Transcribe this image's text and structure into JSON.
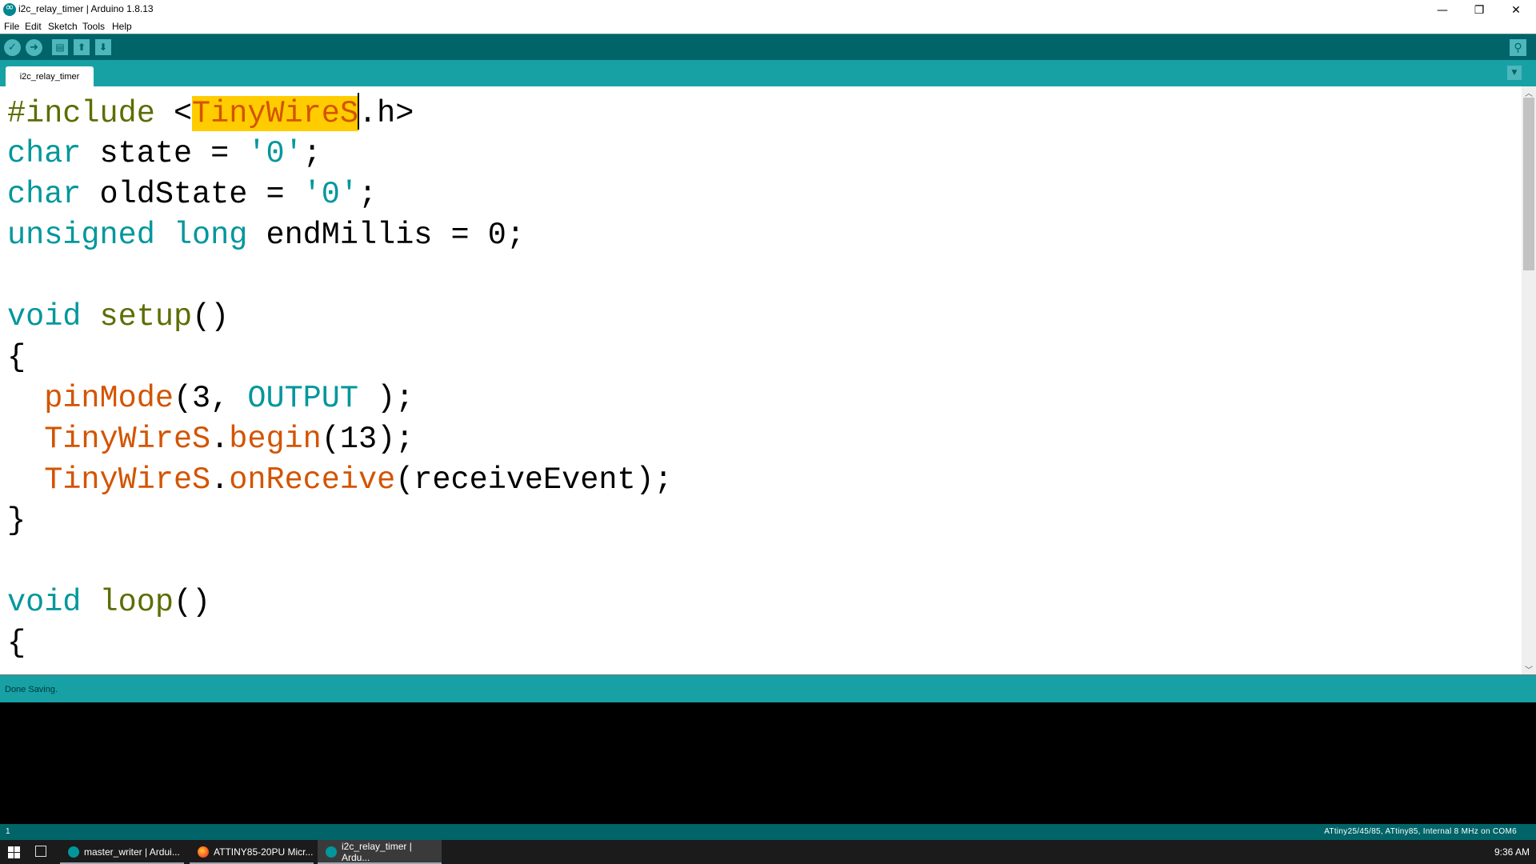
{
  "window": {
    "title": "i2c_relay_timer | Arduino 1.8.13",
    "controls": {
      "minimize": "—",
      "restore": "❐",
      "close": "✕"
    }
  },
  "menu": [
    "File",
    "Edit",
    "Sketch",
    "Tools",
    "Help"
  ],
  "toolbar": {
    "verify_icon": "✓",
    "upload_icon": "➜",
    "new_icon": "▤",
    "open_icon": "⬆",
    "save_icon": "⬇",
    "serial_monitor_icon": "⚲"
  },
  "tabs": {
    "active": "i2c_relay_timer",
    "menu_icon": "▼"
  },
  "editor": {
    "lines": [
      [
        {
          "t": "#include ",
          "c": "pp"
        },
        {
          "t": "<",
          "c": ""
        },
        {
          "t": "TinyWireS",
          "c": "fn hl"
        },
        {
          "t": "|",
          "c": "cursor"
        },
        {
          "t": ".h>",
          "c": ""
        }
      ],
      [
        {
          "t": "char",
          "c": "kw"
        },
        {
          "t": " state = ",
          "c": ""
        },
        {
          "t": "'0'",
          "c": "str"
        },
        {
          "t": ";",
          "c": ""
        }
      ],
      [
        {
          "t": "char",
          "c": "kw"
        },
        {
          "t": " oldState = ",
          "c": ""
        },
        {
          "t": "'0'",
          "c": "str"
        },
        {
          "t": ";",
          "c": ""
        }
      ],
      [
        {
          "t": "unsigned",
          "c": "kw"
        },
        {
          "t": " ",
          "c": ""
        },
        {
          "t": "long",
          "c": "kw"
        },
        {
          "t": " endMillis = 0;",
          "c": ""
        }
      ],
      [],
      [
        {
          "t": "void",
          "c": "kw"
        },
        {
          "t": " ",
          "c": ""
        },
        {
          "t": "setup",
          "c": "pp"
        },
        {
          "t": "()",
          "c": ""
        }
      ],
      [
        {
          "t": "{",
          "c": ""
        }
      ],
      [
        {
          "t": "  ",
          "c": ""
        },
        {
          "t": "pinMode",
          "c": "fn"
        },
        {
          "t": "(3, ",
          "c": ""
        },
        {
          "t": "OUTPUT",
          "c": "kw"
        },
        {
          "t": " );",
          "c": ""
        }
      ],
      [
        {
          "t": "  ",
          "c": ""
        },
        {
          "t": "TinyWireS",
          "c": "fn"
        },
        {
          "t": ".",
          "c": ""
        },
        {
          "t": "begin",
          "c": "fn"
        },
        {
          "t": "(13);",
          "c": ""
        }
      ],
      [
        {
          "t": "  ",
          "c": ""
        },
        {
          "t": "TinyWireS",
          "c": "fn"
        },
        {
          "t": ".",
          "c": ""
        },
        {
          "t": "onReceive",
          "c": "fn"
        },
        {
          "t": "(receiveEvent);",
          "c": ""
        }
      ],
      [
        {
          "t": "}",
          "c": ""
        }
      ],
      [],
      [
        {
          "t": "void",
          "c": "kw"
        },
        {
          "t": " ",
          "c": ""
        },
        {
          "t": "loop",
          "c": "pp"
        },
        {
          "t": "()",
          "c": ""
        }
      ],
      [
        {
          "t": "{",
          "c": ""
        }
      ]
    ],
    "scroll_up_icon": "︿",
    "scroll_down_icon": "﹀"
  },
  "status": {
    "message": "Done Saving."
  },
  "bottom_status": {
    "line_number": "1",
    "board": "ATtiny25/45/85, ATtiny85, Internal 8 MHz on COM6"
  },
  "taskbar": {
    "items": [
      {
        "label": "master_writer | Ardui...",
        "icon": "arduino-icon",
        "active": false
      },
      {
        "label": "ATTINY85-20PU Micr...",
        "icon": "firefox-icon",
        "active": false
      },
      {
        "label": "i2c_relay_timer | Ardu...",
        "icon": "arduino-icon",
        "active": true
      }
    ],
    "clock": "9:36 AM"
  }
}
